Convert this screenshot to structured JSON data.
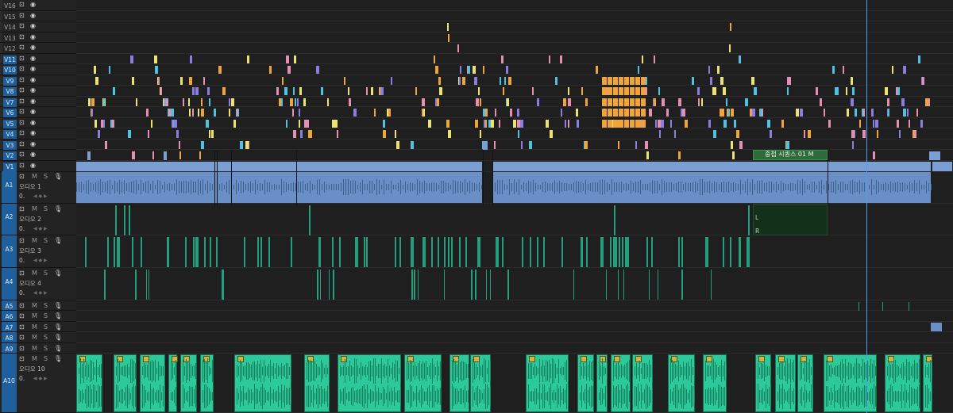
{
  "tracks": {
    "video": [
      {
        "label": "V16",
        "active": false
      },
      {
        "label": "V15",
        "active": false
      },
      {
        "label": "V14",
        "active": false
      },
      {
        "label": "V13",
        "active": false
      },
      {
        "label": "V12",
        "active": false
      },
      {
        "label": "V11",
        "active": true
      },
      {
        "label": "V10",
        "active": true
      },
      {
        "label": "V9",
        "active": true
      },
      {
        "label": "V8",
        "active": true
      },
      {
        "label": "V7",
        "active": true
      },
      {
        "label": "V6",
        "active": true
      },
      {
        "label": "V5",
        "active": true
      },
      {
        "label": "V4",
        "active": true
      },
      {
        "label": "V3",
        "active": true
      },
      {
        "label": "V2",
        "active": true
      },
      {
        "label": "V1",
        "active": true
      }
    ],
    "audio": [
      {
        "label": "A1",
        "name": "오디오 1",
        "volume": "0."
      },
      {
        "label": "A2",
        "name": "오디오 2",
        "volume": "0."
      },
      {
        "label": "A3",
        "name": "오디오 3",
        "volume": "0."
      },
      {
        "label": "A4",
        "name": "오디오 4",
        "volume": "0."
      },
      {
        "label": "A5"
      },
      {
        "label": "A6"
      },
      {
        "label": "A7"
      },
      {
        "label": "A8"
      },
      {
        "label": "A9"
      },
      {
        "label": "A10",
        "name": "오디오 10",
        "volume": "0."
      }
    ],
    "audio_buttons": {
      "mute": "M",
      "solo": "S"
    }
  },
  "nested_sequence": {
    "title": "중첩 시퀀스 01 M",
    "channel_l": "L",
    "channel_r": "R"
  },
  "colors": {
    "label_pink": "#e58fb3",
    "label_cyan": "#4ec2e0",
    "label_yellow": "#ece36f",
    "label_orange": "#f0a53a",
    "label_violet": "#8a7fe0",
    "clip_blue": "#7b9fd3",
    "clip_green": "#2cc99a",
    "track_target_blue": "#1f5f9b",
    "playhead": "#4ea0e8",
    "nested_sequence_green": "#2d6b3a"
  },
  "icons": {
    "visibility": "eye-icon",
    "sync_lock": "film-toggle-icon",
    "voice_over": "microphone-icon",
    "keyframe_nav": "keyframe-navigation-icon"
  }
}
